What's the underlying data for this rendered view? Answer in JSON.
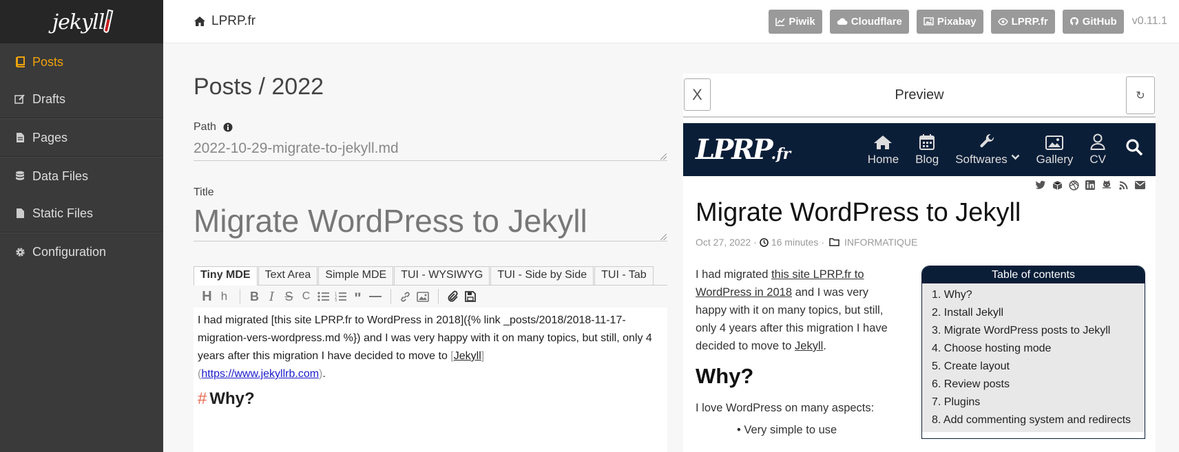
{
  "sidebar": {
    "logo": "jekyll",
    "items": [
      {
        "label": "Posts"
      },
      {
        "label": "Drafts"
      },
      {
        "label": "Pages"
      },
      {
        "label": "Data Files"
      },
      {
        "label": "Static Files"
      },
      {
        "label": "Configuration"
      }
    ]
  },
  "topbar": {
    "site": "LPRP.fr",
    "buttons": [
      {
        "label": "Piwik"
      },
      {
        "label": "Cloudflare"
      },
      {
        "label": "Pixabay"
      },
      {
        "label": "LPRP.fr"
      },
      {
        "label": "GitHub"
      }
    ],
    "version": "v0.11.1"
  },
  "editor": {
    "heading": "Posts / 2022",
    "path_label": "Path",
    "path_value": "2022-10-29-migrate-to-jekyll.md",
    "title_label": "Title",
    "title_value": "Migrate WordPress to Jekyll",
    "tabs": [
      {
        "label": "Tiny MDE"
      },
      {
        "label": "Text Area"
      },
      {
        "label": "Simple MDE"
      },
      {
        "label": "TUI - WYSIWYG"
      },
      {
        "label": "TUI - Side by Side"
      },
      {
        "label": "TUI - Tab"
      }
    ],
    "body": {
      "p1": "I had migrated [this site LPRP.fr to WordPress in 2018]({% link _posts/2018/2018-11-17-migration-vers-wordpress.md %}) and I was very happy with it on many topics, but still, only 4 years after this migration I have decided to move to ",
      "link_text": "Jekyll",
      "link_url": "https://www.jekyllrb.com",
      "end": ".",
      "heading_hash": "#",
      "heading": "Why?"
    }
  },
  "preview": {
    "title": "Preview",
    "close_label": "X",
    "refresh_label": "↻",
    "site": {
      "logo_main": "LPRP",
      "logo_suffix": ".fr",
      "menu": [
        {
          "label": "Home"
        },
        {
          "label": "Blog"
        },
        {
          "label": "Softwares"
        },
        {
          "label": "Gallery"
        },
        {
          "label": "CV"
        }
      ]
    },
    "article": {
      "title": "Migrate WordPress to Jekyll",
      "date": "Oct 27, 2022",
      "sep1": "·",
      "duration": "16 minutes",
      "sep2": "·",
      "category": "INFORMATIQUE",
      "intro_before": "I had migrated ",
      "intro_link": "this site LPRP.fr to WordPress in 2018",
      "intro_mid": " and I was very happy with it on many topics, but still, only 4 years after this migration I have decided to move to ",
      "intro_link2": "Jekyll",
      "intro_end": ".",
      "why": "Why?",
      "why_text": "I love WordPress on many aspects:",
      "bullet": "Very simple to use"
    },
    "toc": {
      "title": "Table of contents",
      "items": [
        "1. Why?",
        "2. Install Jekyll",
        "3. Migrate WordPress posts to Jekyll",
        "4. Choose hosting mode",
        "5. Create layout",
        "6. Review posts",
        "7. Plugins",
        "8. Add commenting system and redirects"
      ]
    }
  },
  "colors": {
    "accent": "#f0a30a",
    "sidebar": "#3a3a3a",
    "site_nav": "#0b1e38",
    "button": "#9a9a9a"
  }
}
